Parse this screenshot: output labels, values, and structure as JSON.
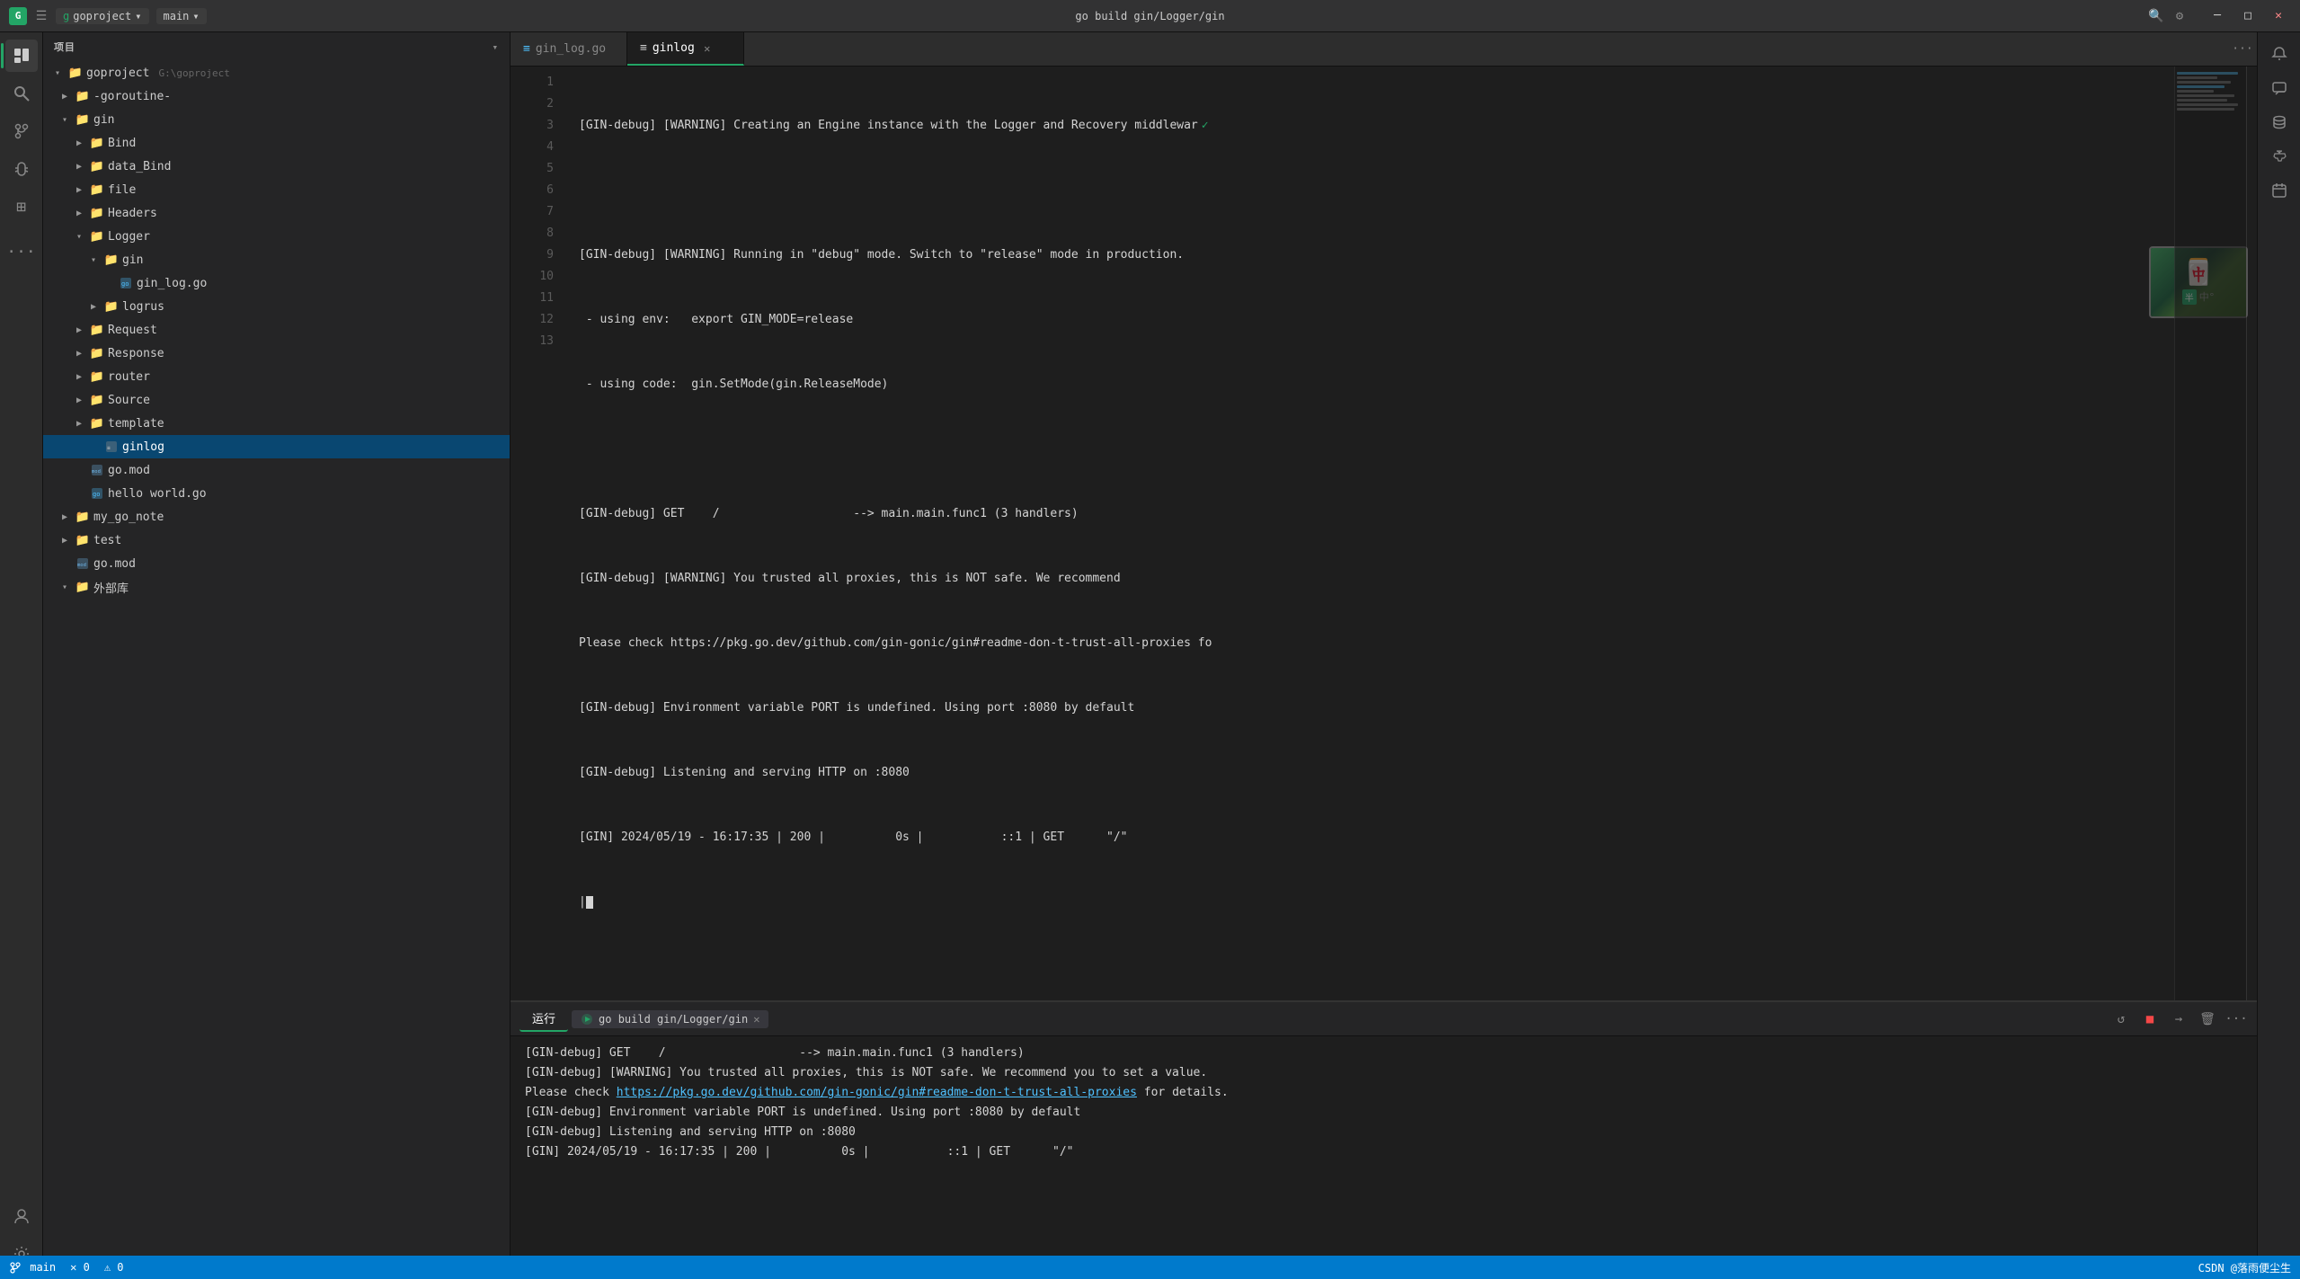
{
  "titlebar": {
    "project_icon": "G",
    "project_name": "goproject",
    "branch_name": "main",
    "title": "go build gin/Logger/gin",
    "hamburger": "☰",
    "minimize": "─",
    "maximize": "□",
    "close": "✕"
  },
  "activity": {
    "items": [
      {
        "name": "explorer",
        "icon": "📋",
        "active": true
      },
      {
        "name": "search",
        "icon": "🔍"
      },
      {
        "name": "git",
        "icon": "⎇"
      },
      {
        "name": "debug",
        "icon": "🐛"
      },
      {
        "name": "extensions",
        "icon": "⊞"
      }
    ],
    "bottom": [
      {
        "name": "accounts",
        "icon": "👤"
      },
      {
        "name": "settings",
        "icon": "⚙"
      }
    ]
  },
  "sidebar": {
    "header": "项目",
    "tree": {
      "goproject": {
        "label": "goproject",
        "path": "G:\\goproject",
        "expanded": true,
        "children": {
          "goroutine": {
            "label": "-goroutine-",
            "indent": 1
          },
          "gin": {
            "label": "gin",
            "indent": 1,
            "expanded": true,
            "children": {
              "Bind": {
                "label": "Bind",
                "indent": 2
              },
              "data_Bind": {
                "label": "data_Bind",
                "indent": 2
              },
              "file": {
                "label": "file",
                "indent": 2
              },
              "Headers": {
                "label": "Headers",
                "indent": 2
              },
              "Logger": {
                "label": "Logger",
                "indent": 2,
                "expanded": true,
                "children": {
                  "gin_sub": {
                    "label": "gin",
                    "indent": 3,
                    "expanded": true,
                    "children": {
                      "gin_log_go": {
                        "label": "gin_log.go",
                        "indent": 4,
                        "type": "file-go"
                      }
                    }
                  },
                  "logrus": {
                    "label": "logrus",
                    "indent": 3
                  }
                }
              },
              "Request": {
                "label": "Request",
                "indent": 2
              },
              "Response": {
                "label": "Response",
                "indent": 2
              },
              "router": {
                "label": "router",
                "indent": 2
              },
              "Source": {
                "label": "Source",
                "indent": 2
              },
              "template": {
                "label": "template",
                "indent": 2
              },
              "ginlog": {
                "label": "ginlog",
                "indent": 3,
                "type": "file",
                "active": true
              },
              "go_mod": {
                "label": "go.mod",
                "indent": 2,
                "type": "file-mod"
              },
              "hello_world": {
                "label": "hello world.go",
                "indent": 2,
                "type": "file-go"
              }
            }
          },
          "my_go_note": {
            "label": "my_go_note",
            "indent": 1
          },
          "test": {
            "label": "test",
            "indent": 1
          },
          "go_mod_root": {
            "label": "go.mod",
            "indent": 1,
            "type": "file-mod"
          },
          "waibu": {
            "label": "外部库",
            "indent": 1
          }
        }
      }
    }
  },
  "tabs": [
    {
      "label": "gin_log.go",
      "icon": "≡",
      "active": false,
      "closable": false
    },
    {
      "label": "ginlog",
      "icon": "≡",
      "active": true,
      "closable": true
    }
  ],
  "editor": {
    "lines": [
      {
        "num": 1,
        "content": "[GIN-debug] [WARNING] Creating an Engine instance with the Logger and Recovery middlewar",
        "checkmark": true
      },
      {
        "num": 2,
        "content": ""
      },
      {
        "num": 3,
        "content": "[GIN-debug] [WARNING] Running in \"debug\" mode. Switch to \"release\" mode in production."
      },
      {
        "num": 4,
        "content": " - using env:   export GIN_MODE=release"
      },
      {
        "num": 5,
        "content": " - using code:  gin.SetMode(gin.ReleaseMode)"
      },
      {
        "num": 6,
        "content": ""
      },
      {
        "num": 7,
        "content": "[GIN-debug] GET    /                   --> main.main.func1 (3 handlers)"
      },
      {
        "num": 8,
        "content": "[GIN-debug] [WARNING] You trusted all proxies, this is NOT safe. We recommend"
      },
      {
        "num": 9,
        "content": "Please check https://pkg.go.dev/github.com/gin-gonic/gin#readme-don-t-trust-all-proxies fo"
      },
      {
        "num": 10,
        "content": "[GIN-debug] Environment variable PORT is undefined. Using port :8080 by default"
      },
      {
        "num": 11,
        "content": "[GIN-debug] Listening and serving HTTP on :8080"
      },
      {
        "num": 12,
        "content": "[GIN] 2024/05/19 - 16:17:35 | 200 |          0s |           ::1 | GET      \"/\""
      },
      {
        "num": 13,
        "content": "|"
      }
    ]
  },
  "terminal": {
    "panel_label": "运行",
    "run_tab_label": "go build gin/Logger/gin",
    "lines": [
      {
        "text": "[GIN-debug] GET    /                   --> main.main.func1 (3 handlers)",
        "type": "normal"
      },
      {
        "text": "[GIN-debug] [WARNING] You trusted all proxies, this is NOT safe. We recommend you to set a value.",
        "type": "normal"
      },
      {
        "text": "Please check ",
        "type": "normal",
        "link": "https://pkg.go.dev/github.com/gin-gonic/gin#readme-don-t-trust-all-proxies",
        "link_text": "https://pkg.go.dev/github.com/gin-gonic/gin#readme-don-t-trust-all-proxies",
        "after_link": " for details."
      },
      {
        "text": "[GIN-debug] Environment variable PORT is undefined. Using port :8080 by default",
        "type": "normal"
      },
      {
        "text": "[GIN-debug] Listening and serving HTTP on :8080",
        "type": "normal"
      },
      {
        "text": "[GIN] 2024/05/19 - 16:17:35 | 200 |          0s |           ::1 | GET      \"/\"",
        "type": "normal"
      }
    ]
  },
  "status_bar": {
    "branch": "main",
    "errors": "0",
    "warnings": "0",
    "right": "CSDN @落雨便尘生"
  },
  "overlay": {
    "emoji1": "🀄",
    "text": "半中"
  }
}
